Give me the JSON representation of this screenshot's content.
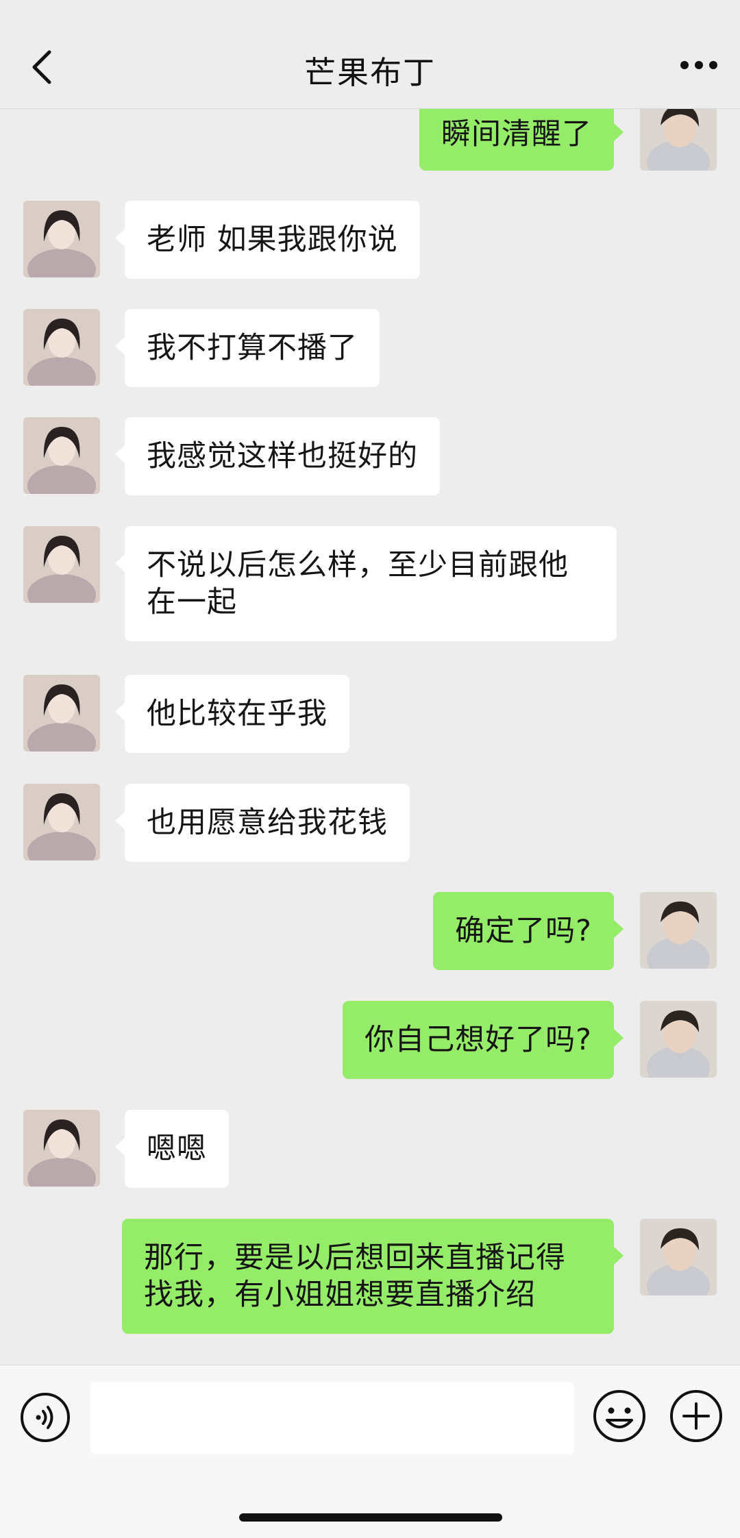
{
  "header": {
    "title": "芒果布丁",
    "back_icon": "chevron-left-icon",
    "more_icon": "more-dots-icon"
  },
  "colors": {
    "background": "#ededed",
    "bubble_out": "#95ec69",
    "bubble_in": "#ffffff"
  },
  "messages": [
    {
      "side": "out",
      "text": "瞬间清醒了"
    },
    {
      "side": "in",
      "text": "老师 如果我跟你说"
    },
    {
      "side": "in",
      "text": "我不打算不播了"
    },
    {
      "side": "in",
      "text": "我感觉这样也挺好的"
    },
    {
      "side": "in",
      "text": "不说以后怎么样，至少目前跟他在一起"
    },
    {
      "side": "in",
      "text": "他比较在乎我"
    },
    {
      "side": "in",
      "text": "也用愿意给我花钱"
    },
    {
      "side": "out",
      "text": "确定了吗?"
    },
    {
      "side": "out",
      "text": "你自己想好了吗?"
    },
    {
      "side": "in",
      "text": "嗯嗯"
    },
    {
      "side": "out",
      "text": "那行，要是以后想回来直播记得找我，有小姐姐想要直播介绍"
    }
  ],
  "input_bar": {
    "placeholder": "",
    "voice_icon": "voice-icon",
    "emoji_icon": "emoji-icon",
    "plus_icon": "plus-icon"
  }
}
